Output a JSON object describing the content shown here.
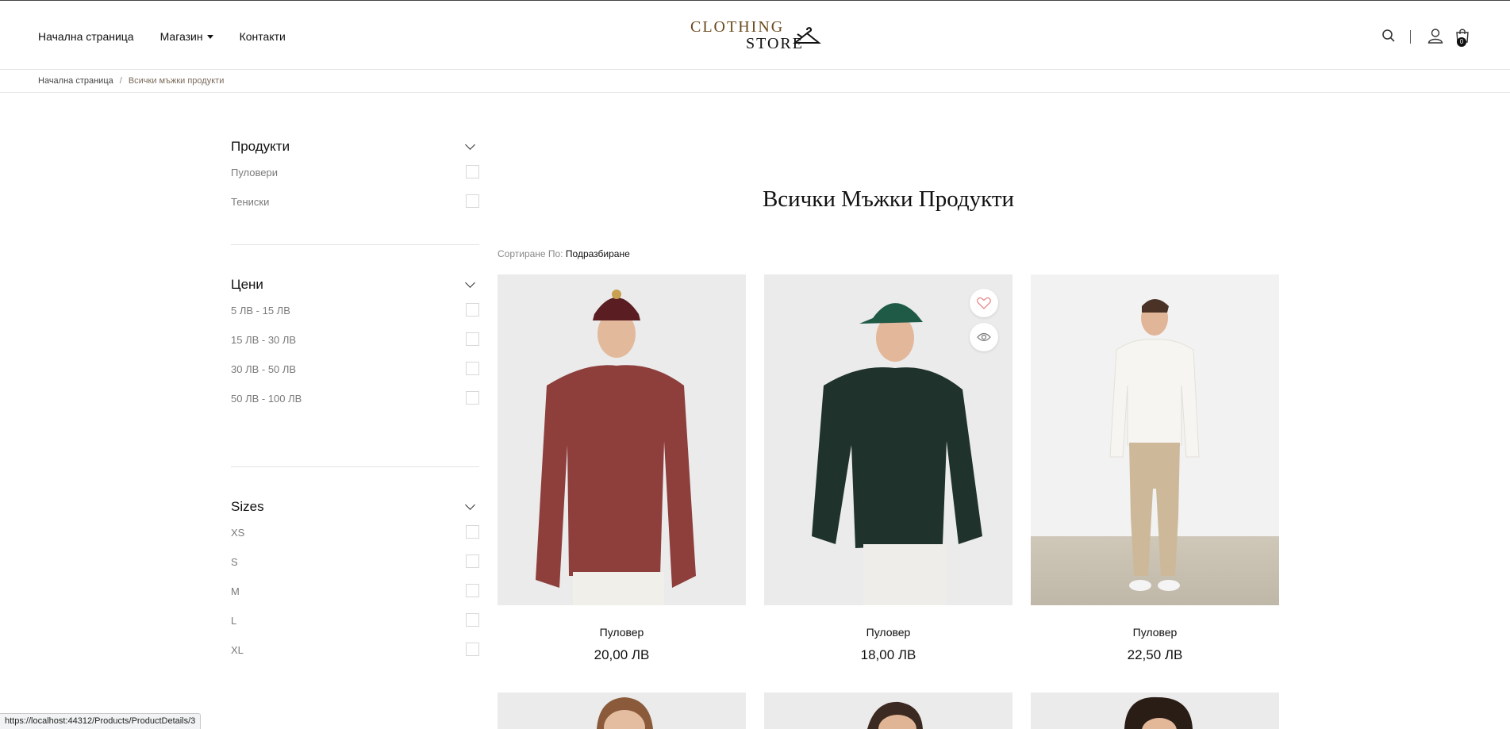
{
  "header": {
    "nav": [
      {
        "label": "Начална страница"
      },
      {
        "label": "Магазин"
      },
      {
        "label": "Контакти"
      }
    ],
    "logo": {
      "line1": "CLOTHING",
      "line2": "STORE"
    },
    "cart_count": "0"
  },
  "breadcrumb": {
    "home": "Начална страница",
    "separator": "/",
    "current": "Всички мъжки продукти"
  },
  "filters": [
    {
      "title": "Продукти",
      "items": [
        "Пуловери",
        "Тениски"
      ]
    },
    {
      "title": "Цени",
      "items": [
        "5 ЛВ - 15 ЛВ",
        "15 ЛВ - 30 ЛВ",
        "30 ЛВ - 50 ЛВ",
        "50 ЛВ - 100 ЛВ"
      ]
    },
    {
      "title": "Sizes",
      "items": [
        "XS",
        "S",
        "M",
        "L",
        "XL"
      ]
    }
  ],
  "main": {
    "title": "Всички Мъжки Продукти",
    "sort_label": "Сортиране По:",
    "sort_value": "Подразбиране"
  },
  "products": [
    {
      "name": "Пуловер",
      "price": "20,00 ЛВ",
      "sweater_color": "#8e3e3b",
      "cap_color": "#5a1e22"
    },
    {
      "name": "Пуловер",
      "price": "18,00 ЛВ",
      "sweater_color": "#1f332c",
      "cap_color": "#1f5a47"
    },
    {
      "name": "Пуловер",
      "price": "22,50 ЛВ",
      "sweater_color": "#f5f3ef",
      "cap_color": ""
    }
  ],
  "status_bar": "https://localhost:44312/Products/ProductDetails/3",
  "colors": {
    "accent_brown": "#6b4a1e",
    "text": "#111111",
    "muted": "#7a7a7a"
  }
}
